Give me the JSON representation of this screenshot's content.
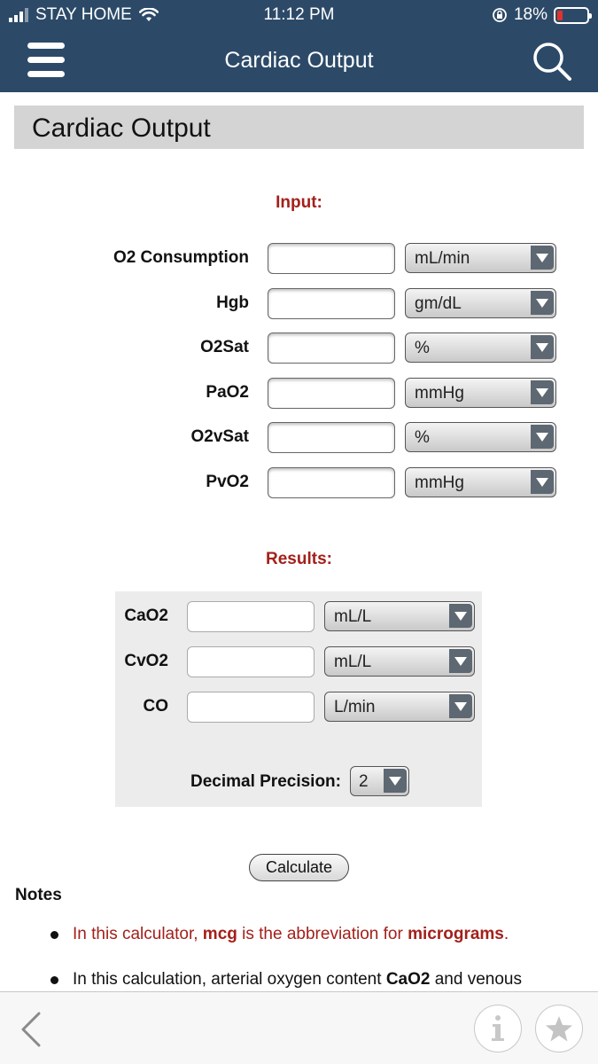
{
  "status_bar": {
    "carrier": "STAY HOME",
    "time": "11:12 PM",
    "battery": "18%"
  },
  "nav": {
    "title": "Cardiac Output",
    "menu_icon": "hamburger-menu-icon",
    "search_icon": "search-icon"
  },
  "page": {
    "heading": "Cardiac Output"
  },
  "input": {
    "title": "Input:",
    "rows": [
      {
        "label": "O2 Consumption",
        "value": "",
        "unit": "mL/min"
      },
      {
        "label": "Hgb",
        "value": "",
        "unit": "gm/dL"
      },
      {
        "label": "O2Sat",
        "value": "",
        "unit": "%"
      },
      {
        "label": "PaO2",
        "value": "",
        "unit": "mmHg"
      },
      {
        "label": "O2vSat",
        "value": "",
        "unit": "%"
      },
      {
        "label": "PvO2",
        "value": "",
        "unit": "mmHg"
      }
    ]
  },
  "results": {
    "title": "Results:",
    "rows": [
      {
        "label": "CaO2",
        "value": "",
        "unit": "mL/L"
      },
      {
        "label": "CvO2",
        "value": "",
        "unit": "mL/L"
      },
      {
        "label": "CO",
        "value": "",
        "unit": "L/min"
      }
    ],
    "precision_label": "Decimal Precision:",
    "precision_value": "2"
  },
  "calculate_label": "Calculate",
  "notes": {
    "title": "Notes",
    "note1": {
      "a": "In this calculator, ",
      "b": "mcg",
      "c": " is the abbreviation for ",
      "d": "micrograms",
      "e": "."
    },
    "note2": {
      "a": "In this calculation, arterial oxygen content ",
      "b": "CaO2",
      "c": " and venous"
    }
  },
  "toolbar": {
    "back_icon": "chevron-left-icon",
    "info_icon": "info-icon",
    "star_icon": "star-icon"
  },
  "colors": {
    "header": "#2c4a68",
    "section_title": "#a3201a",
    "battery_low": "#e0332b"
  }
}
